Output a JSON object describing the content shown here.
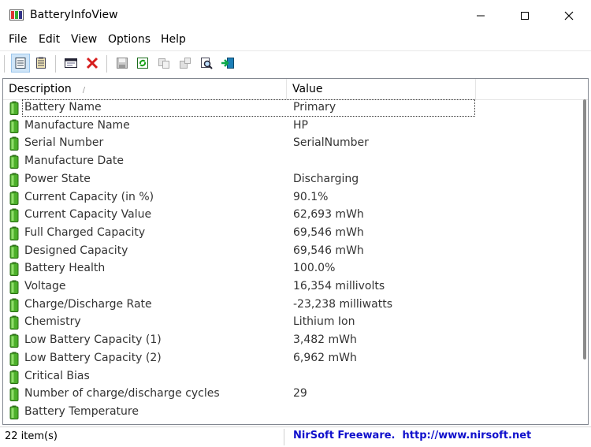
{
  "window": {
    "title": "BatteryInfoView",
    "minimize": "—",
    "maximize": "☐",
    "close": "✕"
  },
  "menu": [
    "File",
    "Edit",
    "View",
    "Options",
    "Help"
  ],
  "toolbar": {
    "buttons": [
      {
        "name": "battery-info-mode-icon"
      },
      {
        "name": "battery-log-mode-icon"
      },
      {
        "name": "properties-window-icon"
      },
      {
        "name": "delete-x-icon"
      },
      {
        "name": "save-disk-icon"
      },
      {
        "name": "refresh-icon"
      },
      {
        "name": "copy-icon"
      },
      {
        "name": "options-icon"
      },
      {
        "name": "find-icon"
      },
      {
        "name": "exit-icon"
      }
    ]
  },
  "list": {
    "columns": [
      "Description",
      "Value"
    ],
    "sort_marker": "/",
    "rows": [
      {
        "desc": "Battery Name",
        "value": "Primary"
      },
      {
        "desc": "Manufacture Name",
        "value": "HP"
      },
      {
        "desc": "Serial Number",
        "value": "SerialNumber"
      },
      {
        "desc": "Manufacture Date",
        "value": ""
      },
      {
        "desc": "Power State",
        "value": "Discharging"
      },
      {
        "desc": "Current Capacity (in %)",
        "value": "90.1%"
      },
      {
        "desc": "Current Capacity Value",
        "value": "62,693 mWh"
      },
      {
        "desc": "Full Charged Capacity",
        "value": "69,546 mWh"
      },
      {
        "desc": "Designed Capacity",
        "value": "69,546 mWh"
      },
      {
        "desc": "Battery Health",
        "value": "100.0%"
      },
      {
        "desc": "Voltage",
        "value": "16,354 millivolts"
      },
      {
        "desc": "Charge/Discharge Rate",
        "value": "-23,238 milliwatts"
      },
      {
        "desc": "Chemistry",
        "value": "Lithium Ion"
      },
      {
        "desc": "Low Battery Capacity (1)",
        "value": "3,482 mWh"
      },
      {
        "desc": "Low Battery Capacity (2)",
        "value": "6,962 mWh"
      },
      {
        "desc": "Critical Bias",
        "value": ""
      },
      {
        "desc": "Number of charge/discharge cycles",
        "value": "29"
      },
      {
        "desc": "Battery Temperature",
        "value": ""
      }
    ]
  },
  "status": {
    "items": "22 item(s)",
    "link": "NirSoft Freeware.  http://www.nirsoft.net"
  },
  "colors": {
    "battery_green": "#4caf2a",
    "link_blue": "#1010cc"
  }
}
